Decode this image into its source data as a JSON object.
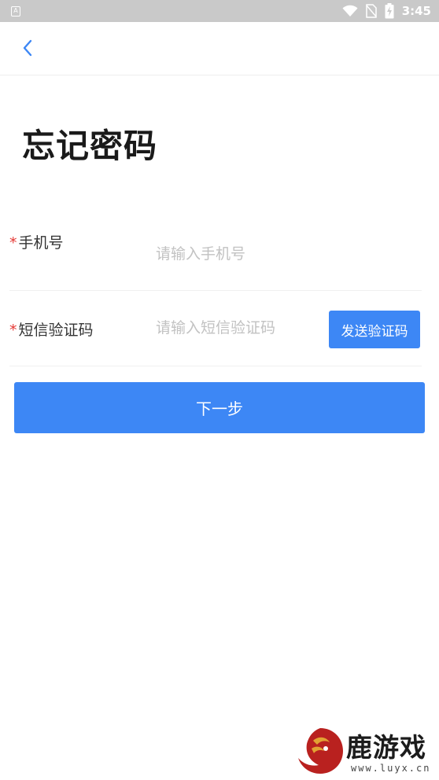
{
  "status_bar": {
    "notification_icon_letter": "A",
    "time": "3:45",
    "icons": [
      "a-notification-icon",
      "wifi-icon",
      "no-sim-icon",
      "battery-charging-icon"
    ]
  },
  "nav": {
    "back_icon": "chevron-left-icon"
  },
  "page": {
    "title": "忘记密码"
  },
  "form": {
    "phone": {
      "required_mark": "*",
      "label": "手机号",
      "placeholder": "请输入手机号",
      "value": ""
    },
    "sms_code": {
      "required_mark": "*",
      "label": "短信验证码",
      "placeholder": "请输入短信验证码",
      "value": "",
      "send_button_label": "发送验证码"
    },
    "next_button_label": "下一步"
  },
  "colors": {
    "accent": "#3d87f5",
    "required": "#e53935",
    "placeholder": "#c2c2c2",
    "status_bar": "#c9c9c9"
  },
  "watermark": {
    "brand": "鹿游戏",
    "url": "www.luyx.cn"
  }
}
